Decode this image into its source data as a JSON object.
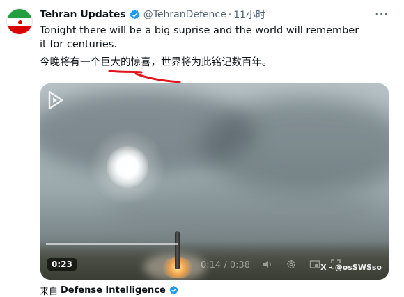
{
  "tweet": {
    "author_name": "Tehran Updates",
    "handle": "@TehranDefence",
    "separator": "·",
    "time": "11小时",
    "more_label": "···",
    "text_en": "Tonight there will be a big suprise and the world will remember it for centuries.",
    "text_zh": "今晚将有一个巨大的惊喜，世界将为此铭记数百年。"
  },
  "media": {
    "duration_badge": "0:23",
    "playback_time": "0:14 / 0:38",
    "watermark": "X - @osSWSso",
    "icons": [
      "volume-icon",
      "settings-gear-icon",
      "pip-icon",
      "fullscreen-icon"
    ]
  },
  "footer": {
    "prefix": "来自",
    "source": "Defense Intelligence"
  },
  "colors": {
    "verified_blue": "#1d9bf0",
    "text_primary": "#0f1419",
    "text_secondary": "#536471",
    "red_underline": "#e0141c",
    "flag_green": "#239f40",
    "flag_red": "#da0000"
  }
}
